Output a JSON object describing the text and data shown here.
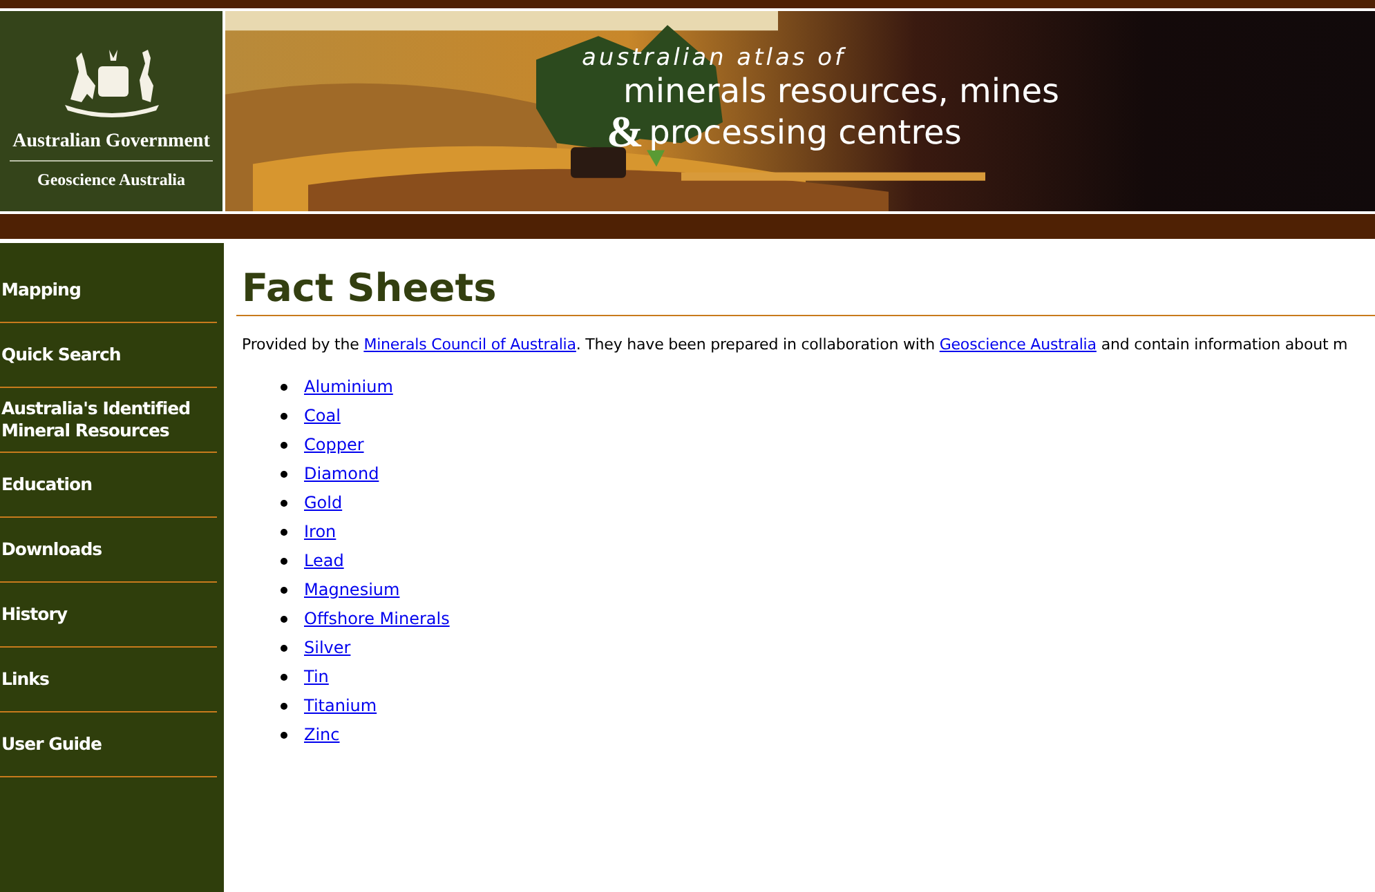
{
  "header": {
    "agency": "Australian Government",
    "department": "Geoscience Australia",
    "banner": {
      "kind": "picture",
      "subtitle": "australian atlas of",
      "title_line_1": "minerals resources, mines",
      "ampersand": "&",
      "title_line_2": "processing centres"
    }
  },
  "sidebar": {
    "items": [
      {
        "label": "Mapping"
      },
      {
        "label": "Quick Search"
      },
      {
        "label": "Australia's Identified Mineral Resources"
      },
      {
        "label": "Education"
      },
      {
        "label": "Downloads"
      },
      {
        "label": "History"
      },
      {
        "label": "Links"
      },
      {
        "label": "User Guide"
      }
    ]
  },
  "content": {
    "title": "Fact Sheets",
    "intro": [
      {
        "kind": "text",
        "text": "Provided by the "
      },
      {
        "kind": "link",
        "text": "Minerals Council of Australia"
      },
      {
        "kind": "text",
        "text": ". They have been prepared in collaboration with "
      },
      {
        "kind": "link",
        "text": "Geoscience Australia"
      },
      {
        "kind": "text",
        "text": " and contain information about m"
      }
    ],
    "links": [
      "Aluminium",
      "Coal",
      "Copper",
      "Diamond",
      "Gold",
      "Iron",
      "Lead",
      "Magnesium",
      "Offshore Minerals",
      "Silver",
      "Tin",
      "Titanium",
      "Zinc"
    ]
  }
}
